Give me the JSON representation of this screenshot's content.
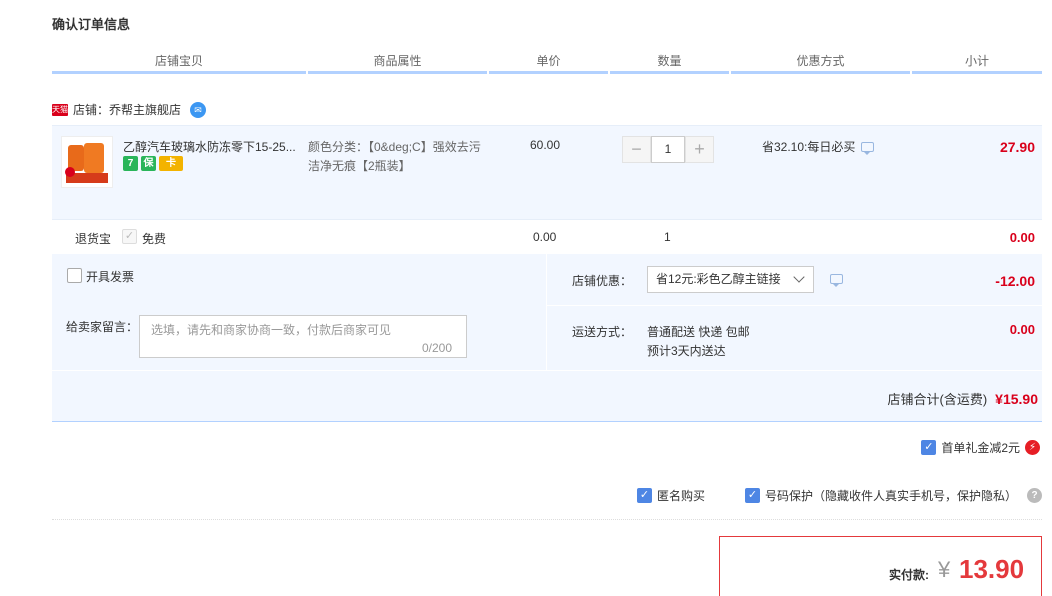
{
  "page": {
    "title": "确认订单信息"
  },
  "columns": [
    "店铺宝贝",
    "商品属性",
    "单价",
    "数量",
    "优惠方式",
    "小计"
  ],
  "shop": {
    "badge": "天猫",
    "label": "店铺：乔帮主旗舰店"
  },
  "item": {
    "title": "乙醇汽车玻璃水防冻零下15-25...",
    "service_icons": [
      "7",
      "保",
      "卡"
    ],
    "attribute": "颜色分类：【0&deg;C】强效去污洁净无痕【2瓶装】",
    "unit_price": "60.00",
    "quantity": "1",
    "minus": "−",
    "plus": "+",
    "promo": "省32.10:每日必买",
    "subtotal": "27.90"
  },
  "insurance": {
    "label": "退货宝",
    "option": "免费",
    "price": "0.00",
    "quantity": "1",
    "subtotal": "0.00"
  },
  "invoice": {
    "label": "开具发票"
  },
  "message": {
    "label": "给卖家留言：",
    "placeholder": "选填，请先和商家协商一致，付款后商家可见",
    "counter": "0/200"
  },
  "shop_discount": {
    "label": "店铺优惠：",
    "selected": "省12元:彩色乙醇主链接",
    "amount": "-12.00"
  },
  "shipping": {
    "label": "运送方式：",
    "method": "普通配送 快递 包邮",
    "eta": "预计3天内送达",
    "amount": "0.00"
  },
  "shop_total": {
    "label": "店铺合计(含运费)",
    "amount": "¥15.90"
  },
  "first_order": {
    "label": "首单礼金减2元"
  },
  "anonymous": {
    "label": "匿名购买"
  },
  "phone_protect": {
    "label": "号码保护（隐藏收件人真实手机号，保护隐私）"
  },
  "payment": {
    "label": "实付款:",
    "currency": "¥",
    "amount": "13.90"
  },
  "colors": {
    "accent_red": "#d9001b",
    "header_bar": "#b2d1ff",
    "panel_bg": "#f2f7ff",
    "checkbox_blue": "#4e86e4"
  }
}
